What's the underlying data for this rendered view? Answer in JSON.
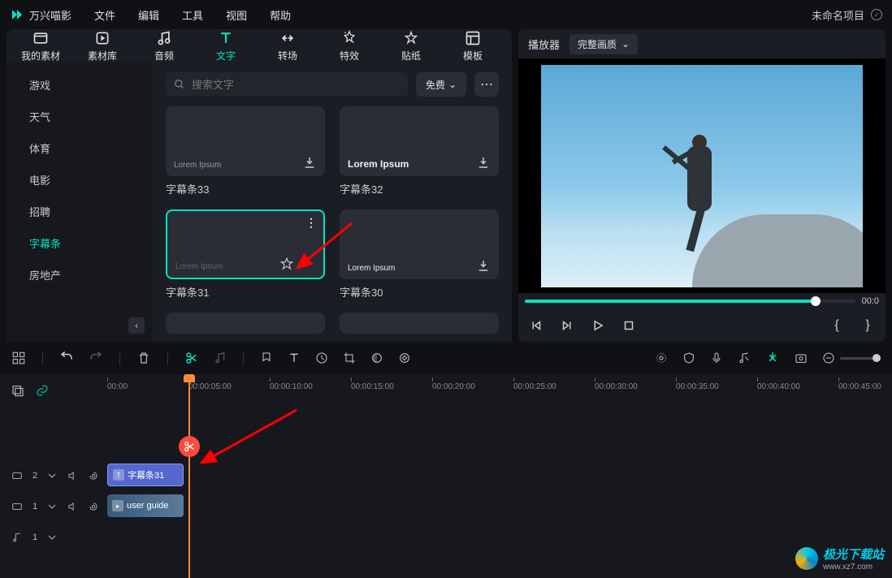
{
  "menubar": {
    "app_name": "万兴喵影",
    "items": [
      "文件",
      "编辑",
      "工具",
      "视图",
      "帮助"
    ],
    "project_name": "未命名项目"
  },
  "tabs": [
    {
      "label": "我的素材"
    },
    {
      "label": "素材库"
    },
    {
      "label": "音频"
    },
    {
      "label": "文字"
    },
    {
      "label": "转场"
    },
    {
      "label": "特效"
    },
    {
      "label": "贴纸"
    },
    {
      "label": "模板"
    }
  ],
  "sidebar": {
    "items": [
      "游戏",
      "天气",
      "体育",
      "电影",
      "招聘",
      "字幕条",
      "房地产"
    ],
    "active": "字幕条"
  },
  "search": {
    "placeholder": "搜索文字",
    "filter": "免费"
  },
  "cards": [
    {
      "label": "字幕条33",
      "lorem": "Lorem Ipsum"
    },
    {
      "label": "字幕条32",
      "lorem": "Lorem Ipsum"
    },
    {
      "label": "字幕条31",
      "lorem": "Lorem Ipsum",
      "selected": true
    },
    {
      "label": "字幕条30",
      "lorem": "Lorem Ipsum"
    }
  ],
  "player": {
    "title": "播放器",
    "quality": "完整画质",
    "time_end": "00:0"
  },
  "timeline": {
    "ticks": [
      "00:00",
      "00:00:05:00",
      "00:00:10:00",
      "00:00:15:00",
      "00:00:20:00",
      "00:00:25:00",
      "00:00:30:00",
      "00:00:35:00",
      "00:00:40:00",
      "00:00:45:00"
    ],
    "track_labels": {
      "t2": "2",
      "t1": "1",
      "a1": "1"
    },
    "clips": {
      "text": "字幕条31",
      "video": "user guide"
    }
  },
  "watermark": {
    "name": "极光下载站",
    "url": "www.xz7.com"
  }
}
